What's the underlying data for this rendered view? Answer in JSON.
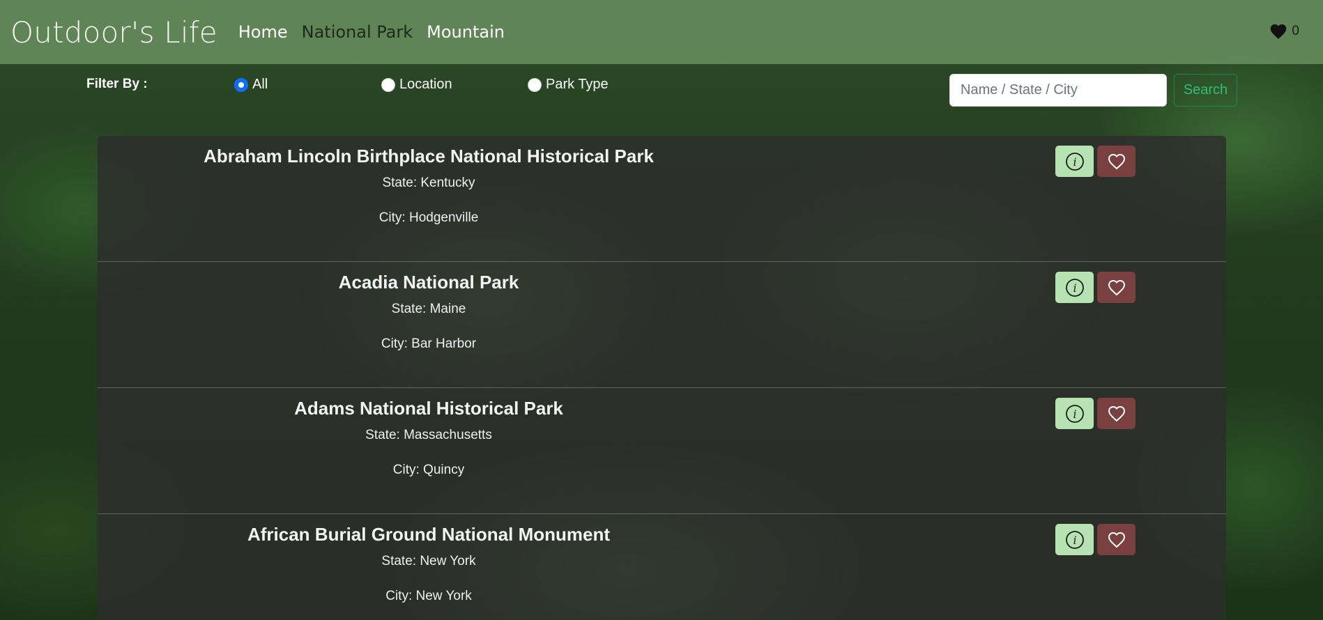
{
  "nav": {
    "brand": "Outdoor's Life",
    "links": [
      "Home",
      "National Park",
      "Mountain"
    ],
    "favorite_count": "0"
  },
  "filter": {
    "label": "Filter By :",
    "options": [
      "All",
      "Location",
      "Park Type"
    ],
    "selected": "All",
    "search_placeholder": "Name / State / City",
    "search_value": "",
    "search_button": "Search"
  },
  "parks": [
    {
      "name": "Abraham Lincoln Birthplace National Historical Park",
      "state": "State: Kentucky",
      "city": "City: Hodgenville"
    },
    {
      "name": "Acadia National Park",
      "state": "State: Maine",
      "city": "City: Bar Harbor"
    },
    {
      "name": "Adams National Historical Park",
      "state": "State: Massachusetts",
      "city": "City: Quincy"
    },
    {
      "name": "African Burial Ground National Monument",
      "state": "State: New York",
      "city": "City: New York"
    }
  ],
  "colors": {
    "navbar": "#6e9664",
    "info_button": "#b6e3b1",
    "favorite_button": "#7a3f3f",
    "search_button": "#198754",
    "radio_checked": "#0d6efd"
  },
  "icons": {
    "favorites": "heart-filled-icon",
    "info": "info-circle-icon",
    "favorite": "heart-outline-icon"
  }
}
